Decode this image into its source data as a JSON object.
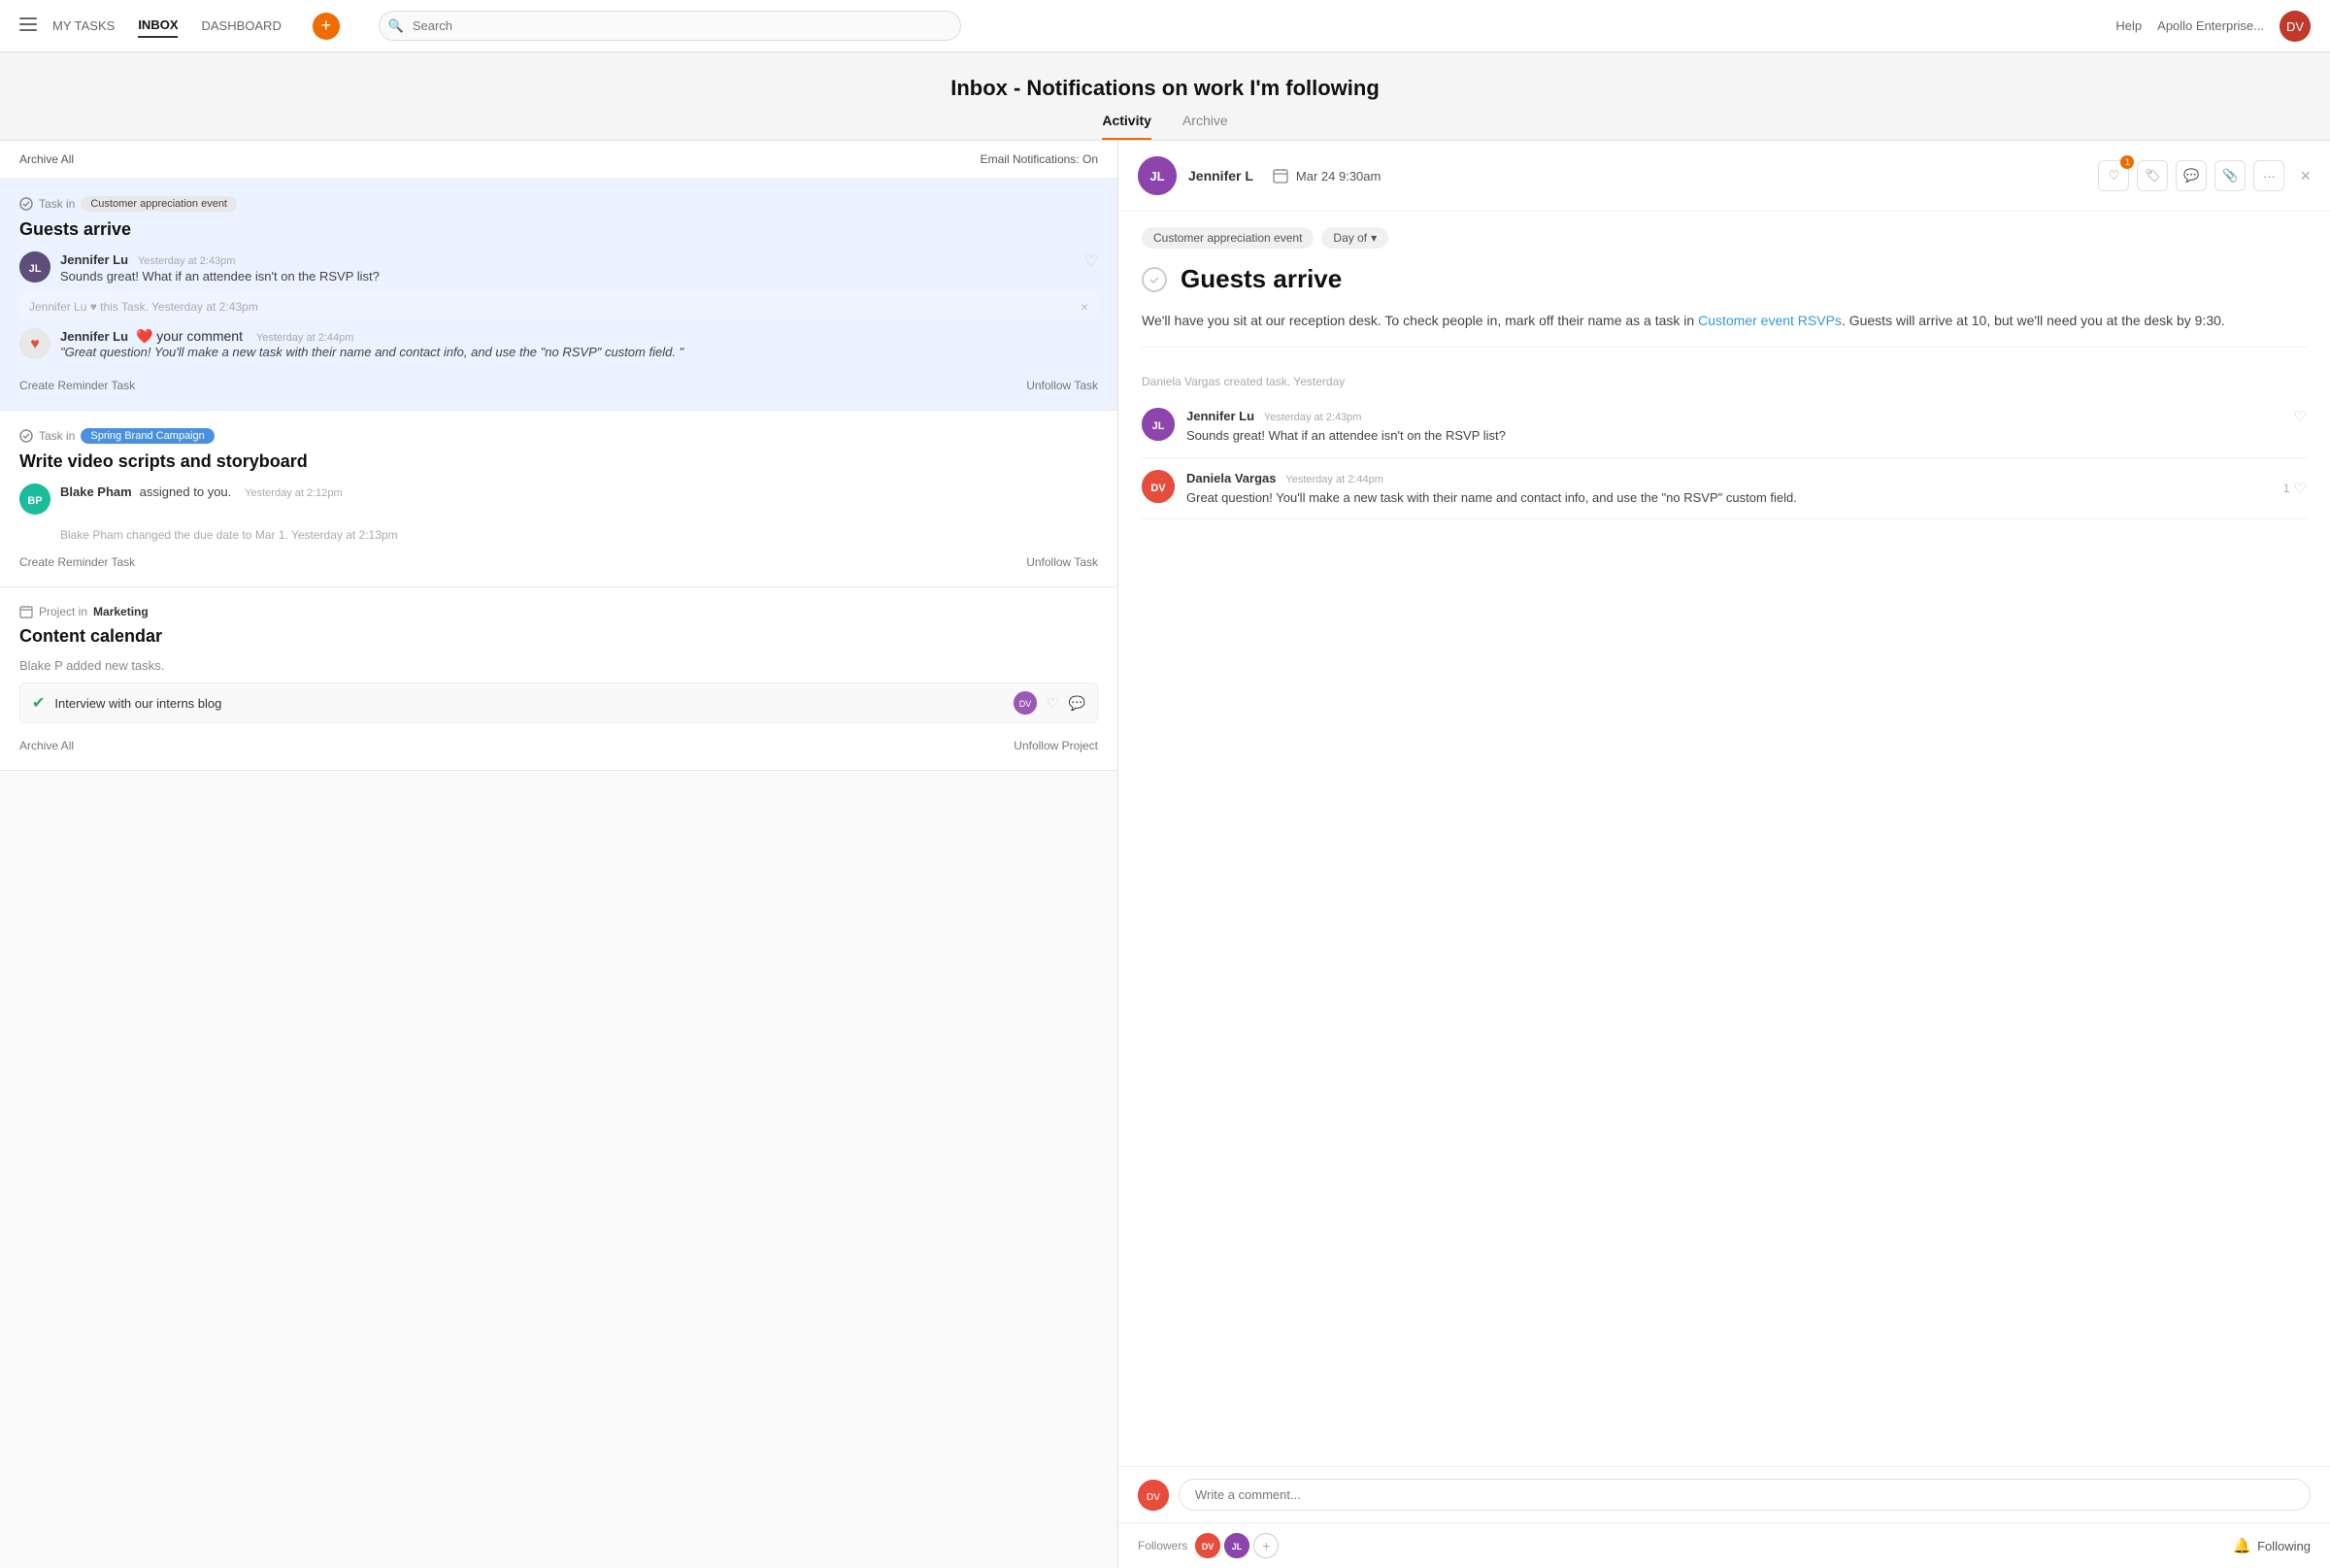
{
  "nav": {
    "my_tasks": "MY TASKS",
    "inbox": "INBOX",
    "dashboard": "DASHBOARD",
    "search_placeholder": "Search",
    "help": "Help",
    "org": "Apollo Enterprise...",
    "plus_icon": "+"
  },
  "page": {
    "title": "Inbox - Notifications on work I'm following",
    "tabs": [
      {
        "label": "Activity",
        "active": true
      },
      {
        "label": "Archive",
        "active": false
      }
    ]
  },
  "left_panel": {
    "archive_all": "Archive All",
    "email_notifications": "Email Notifications: On",
    "cards": [
      {
        "id": "card1",
        "selected": true,
        "type": "Task in",
        "badge": "Customer appreciation event",
        "badge_style": "gray",
        "title": "Guests arrive",
        "activities": [
          {
            "user": "Jennifer Lu",
            "time": "Yesterday at 2:43pm",
            "text": "Sounds great! What if an attendee isn't on the RSVP list?",
            "liked": false
          }
        ],
        "like_sub": "Jennifer Lu ♥ this Task.  Yesterday at 2:43pm",
        "reaction": {
          "user": "Jennifer Lu",
          "reaction_label": "❤️ your comment",
          "time": "Yesterday at 2:44pm",
          "quote": "\"Great question! You'll make a new task with their name and contact info, and use the \"no RSVP\" custom field. \""
        },
        "create_reminder": "Create Reminder Task",
        "unfollow": "Unfollow Task"
      },
      {
        "id": "card2",
        "selected": false,
        "type": "Task in",
        "badge": "Spring Brand Campaign",
        "badge_style": "blue",
        "title": "Write video scripts and storyboard",
        "activities": [
          {
            "user": "Blake Pham",
            "time": "Yesterday at 2:12pm",
            "text": "assigned to you.",
            "is_assign": true
          }
        ],
        "sub_text": "Blake Pham changed the due date to Mar 1.  Yesterday at 2:13pm",
        "create_reminder": "Create Reminder Task",
        "unfollow": "Unfollow Task"
      },
      {
        "id": "card3",
        "selected": false,
        "type": "Project in",
        "badge": "Marketing",
        "badge_style": "plain",
        "title": "Content calendar",
        "added_text": "Blake P added new tasks.",
        "task_items": [
          {
            "name": "Interview with our interns blog",
            "checked": true
          }
        ],
        "create_reminder": "Archive All",
        "unfollow": "Unfollow Project"
      }
    ]
  },
  "right_panel": {
    "user": "Jennifer L",
    "date": "Mar 24 9:30am",
    "close_icon": "×",
    "task_tag": "Customer appreciation event",
    "day_of": "Day of",
    "task_title": "Guests arrive",
    "description_parts": [
      "We'll have you sit at our reception desk. To check people in, mark off their name as a task in ",
      "Customer event RSVPs",
      ". Guests will arrive at 10, but we'll need you at the desk by 9:30."
    ],
    "created_meta": "Daniela Vargas created task.  Yesterday",
    "comments": [
      {
        "user": "Jennifer Lu",
        "time": "Yesterday at 2:43pm",
        "text": "Sounds great! What if an attendee isn't on the RSVP list?",
        "liked": false,
        "like_count": ""
      },
      {
        "user": "Daniela Vargas",
        "time": "Yesterday at 2:44pm",
        "text": "Great question! You'll make a new task with their name and contact info, and use the \"no RSVP\" custom field.",
        "liked": true,
        "like_count": "1"
      }
    ],
    "comment_placeholder": "Write a comment...",
    "followers_label": "Followers",
    "following_label": "Following",
    "action_buttons": [
      "♡",
      "🏷",
      "💬",
      "📎",
      "···"
    ],
    "like_badge": "1"
  }
}
